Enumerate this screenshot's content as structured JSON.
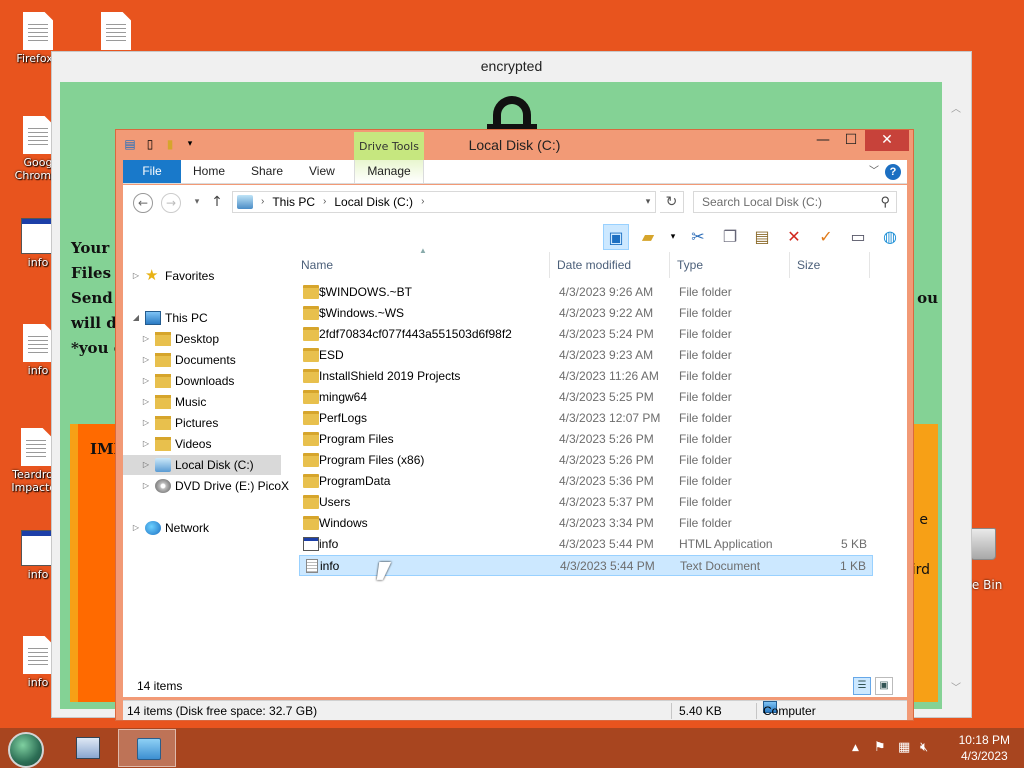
{
  "desktop": {
    "icons": [
      {
        "label": "Firefox.I"
      },
      {
        "label": ""
      },
      {
        "label": "Goog Chrome."
      },
      {
        "label": "info"
      },
      {
        "label": "info"
      },
      {
        "label": "Teardrop Impactor"
      },
      {
        "label": "info"
      },
      {
        "label": "info"
      }
    ],
    "recycle_label": "cle Bin"
  },
  "ransom_window": {
    "title": "encrypted",
    "lines": [
      "Your c",
      "Files a",
      "Send a",
      "will de",
      "*you c"
    ],
    "right_fragment": "ou",
    "important": "IMF",
    "edge1": "e",
    "edge2": "ird"
  },
  "explorer": {
    "title": "Local Disk (C:)",
    "contextual_tab": "Drive Tools",
    "ribbon_tabs": [
      "File",
      "Home",
      "Share",
      "View",
      "Manage"
    ],
    "breadcrumb": [
      "This PC",
      "Local Disk (C:)"
    ],
    "search_placeholder": "Search Local Disk (C:)",
    "nav_pane": {
      "favorites": "Favorites",
      "this_pc": "This PC",
      "children": [
        "Desktop",
        "Documents",
        "Downloads",
        "Music",
        "Pictures",
        "Videos",
        "Local Disk (C:)",
        "DVD Drive (E:) PicoX"
      ],
      "network": "Network"
    },
    "columns": [
      "Name",
      "Date modified",
      "Type",
      "Size"
    ],
    "files": [
      {
        "name": "$WINDOWS.~BT",
        "date": "4/3/2023 9:26 AM",
        "type": "File folder",
        "size": "",
        "kind": "folder"
      },
      {
        "name": "$Windows.~WS",
        "date": "4/3/2023 9:22 AM",
        "type": "File folder",
        "size": "",
        "kind": "folder"
      },
      {
        "name": "2fdf70834cf077f443a551503d6f98f2",
        "date": "4/3/2023 5:24 PM",
        "type": "File folder",
        "size": "",
        "kind": "folder"
      },
      {
        "name": "ESD",
        "date": "4/3/2023 9:23 AM",
        "type": "File folder",
        "size": "",
        "kind": "folder"
      },
      {
        "name": "InstallShield 2019 Projects",
        "date": "4/3/2023 11:26 AM",
        "type": "File folder",
        "size": "",
        "kind": "folder"
      },
      {
        "name": "mingw64",
        "date": "4/3/2023 5:25 PM",
        "type": "File folder",
        "size": "",
        "kind": "folder"
      },
      {
        "name": "PerfLogs",
        "date": "4/3/2023 12:07 PM",
        "type": "File folder",
        "size": "",
        "kind": "folder"
      },
      {
        "name": "Program Files",
        "date": "4/3/2023 5:26 PM",
        "type": "File folder",
        "size": "",
        "kind": "folder"
      },
      {
        "name": "Program Files (x86)",
        "date": "4/3/2023 5:26 PM",
        "type": "File folder",
        "size": "",
        "kind": "folder"
      },
      {
        "name": "ProgramData",
        "date": "4/3/2023 5:36 PM",
        "type": "File folder",
        "size": "",
        "kind": "folder"
      },
      {
        "name": "Users",
        "date": "4/3/2023 5:37 PM",
        "type": "File folder",
        "size": "",
        "kind": "folder"
      },
      {
        "name": "Windows",
        "date": "4/3/2023 3:34 PM",
        "type": "File folder",
        "size": "",
        "kind": "folder"
      },
      {
        "name": "info",
        "date": "4/3/2023 5:44 PM",
        "type": "HTML Application",
        "size": "5 KB",
        "kind": "hta"
      },
      {
        "name": "info",
        "date": "4/3/2023 5:44 PM",
        "type": "Text Document",
        "size": "1 KB",
        "kind": "txt",
        "selected": true
      }
    ],
    "item_count": "14 items",
    "status_left": "14 items (Disk free space: 32.7 GB)",
    "status_size": "5.40 KB",
    "status_location": "Computer"
  },
  "taskbar": {
    "time": "10:18 PM",
    "date": "4/3/2023"
  }
}
